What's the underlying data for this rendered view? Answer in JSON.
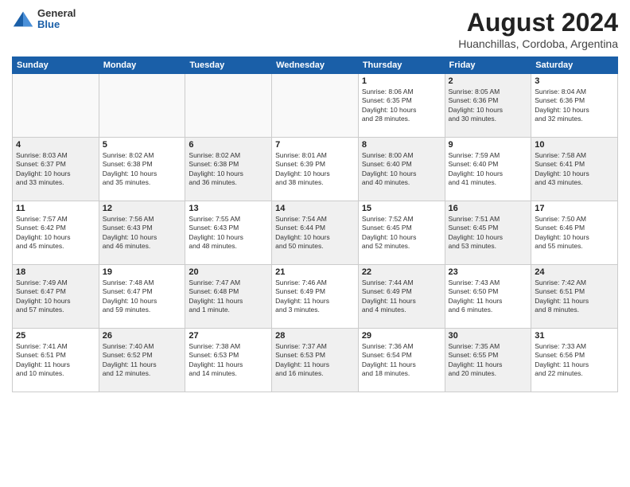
{
  "logo": {
    "general": "General",
    "blue": "Blue"
  },
  "title": "August 2024",
  "subtitle": "Huanchillas, Cordoba, Argentina",
  "headers": [
    "Sunday",
    "Monday",
    "Tuesday",
    "Wednesday",
    "Thursday",
    "Friday",
    "Saturday"
  ],
  "weeks": [
    [
      {
        "day": "",
        "info": "",
        "empty": true
      },
      {
        "day": "",
        "info": "",
        "empty": true
      },
      {
        "day": "",
        "info": "",
        "empty": true
      },
      {
        "day": "",
        "info": "",
        "empty": true
      },
      {
        "day": "1",
        "info": "Sunrise: 8:06 AM\nSunset: 6:35 PM\nDaylight: 10 hours\nand 28 minutes.",
        "shaded": false
      },
      {
        "day": "2",
        "info": "Sunrise: 8:05 AM\nSunset: 6:36 PM\nDaylight: 10 hours\nand 30 minutes.",
        "shaded": true
      },
      {
        "day": "3",
        "info": "Sunrise: 8:04 AM\nSunset: 6:36 PM\nDaylight: 10 hours\nand 32 minutes.",
        "shaded": false
      }
    ],
    [
      {
        "day": "4",
        "info": "Sunrise: 8:03 AM\nSunset: 6:37 PM\nDaylight: 10 hours\nand 33 minutes.",
        "shaded": true
      },
      {
        "day": "5",
        "info": "Sunrise: 8:02 AM\nSunset: 6:38 PM\nDaylight: 10 hours\nand 35 minutes.",
        "shaded": false
      },
      {
        "day": "6",
        "info": "Sunrise: 8:02 AM\nSunset: 6:38 PM\nDaylight: 10 hours\nand 36 minutes.",
        "shaded": true
      },
      {
        "day": "7",
        "info": "Sunrise: 8:01 AM\nSunset: 6:39 PM\nDaylight: 10 hours\nand 38 minutes.",
        "shaded": false
      },
      {
        "day": "8",
        "info": "Sunrise: 8:00 AM\nSunset: 6:40 PM\nDaylight: 10 hours\nand 40 minutes.",
        "shaded": true
      },
      {
        "day": "9",
        "info": "Sunrise: 7:59 AM\nSunset: 6:40 PM\nDaylight: 10 hours\nand 41 minutes.",
        "shaded": false
      },
      {
        "day": "10",
        "info": "Sunrise: 7:58 AM\nSunset: 6:41 PM\nDaylight: 10 hours\nand 43 minutes.",
        "shaded": true
      }
    ],
    [
      {
        "day": "11",
        "info": "Sunrise: 7:57 AM\nSunset: 6:42 PM\nDaylight: 10 hours\nand 45 minutes.",
        "shaded": false
      },
      {
        "day": "12",
        "info": "Sunrise: 7:56 AM\nSunset: 6:43 PM\nDaylight: 10 hours\nand 46 minutes.",
        "shaded": true
      },
      {
        "day": "13",
        "info": "Sunrise: 7:55 AM\nSunset: 6:43 PM\nDaylight: 10 hours\nand 48 minutes.",
        "shaded": false
      },
      {
        "day": "14",
        "info": "Sunrise: 7:54 AM\nSunset: 6:44 PM\nDaylight: 10 hours\nand 50 minutes.",
        "shaded": true
      },
      {
        "day": "15",
        "info": "Sunrise: 7:52 AM\nSunset: 6:45 PM\nDaylight: 10 hours\nand 52 minutes.",
        "shaded": false
      },
      {
        "day": "16",
        "info": "Sunrise: 7:51 AM\nSunset: 6:45 PM\nDaylight: 10 hours\nand 53 minutes.",
        "shaded": true
      },
      {
        "day": "17",
        "info": "Sunrise: 7:50 AM\nSunset: 6:46 PM\nDaylight: 10 hours\nand 55 minutes.",
        "shaded": false
      }
    ],
    [
      {
        "day": "18",
        "info": "Sunrise: 7:49 AM\nSunset: 6:47 PM\nDaylight: 10 hours\nand 57 minutes.",
        "shaded": true
      },
      {
        "day": "19",
        "info": "Sunrise: 7:48 AM\nSunset: 6:47 PM\nDaylight: 10 hours\nand 59 minutes.",
        "shaded": false
      },
      {
        "day": "20",
        "info": "Sunrise: 7:47 AM\nSunset: 6:48 PM\nDaylight: 11 hours\nand 1 minute.",
        "shaded": true
      },
      {
        "day": "21",
        "info": "Sunrise: 7:46 AM\nSunset: 6:49 PM\nDaylight: 11 hours\nand 3 minutes.",
        "shaded": false
      },
      {
        "day": "22",
        "info": "Sunrise: 7:44 AM\nSunset: 6:49 PM\nDaylight: 11 hours\nand 4 minutes.",
        "shaded": true
      },
      {
        "day": "23",
        "info": "Sunrise: 7:43 AM\nSunset: 6:50 PM\nDaylight: 11 hours\nand 6 minutes.",
        "shaded": false
      },
      {
        "day": "24",
        "info": "Sunrise: 7:42 AM\nSunset: 6:51 PM\nDaylight: 11 hours\nand 8 minutes.",
        "shaded": true
      }
    ],
    [
      {
        "day": "25",
        "info": "Sunrise: 7:41 AM\nSunset: 6:51 PM\nDaylight: 11 hours\nand 10 minutes.",
        "shaded": false
      },
      {
        "day": "26",
        "info": "Sunrise: 7:40 AM\nSunset: 6:52 PM\nDaylight: 11 hours\nand 12 minutes.",
        "shaded": true
      },
      {
        "day": "27",
        "info": "Sunrise: 7:38 AM\nSunset: 6:53 PM\nDaylight: 11 hours\nand 14 minutes.",
        "shaded": false
      },
      {
        "day": "28",
        "info": "Sunrise: 7:37 AM\nSunset: 6:53 PM\nDaylight: 11 hours\nand 16 minutes.",
        "shaded": true
      },
      {
        "day": "29",
        "info": "Sunrise: 7:36 AM\nSunset: 6:54 PM\nDaylight: 11 hours\nand 18 minutes.",
        "shaded": false
      },
      {
        "day": "30",
        "info": "Sunrise: 7:35 AM\nSunset: 6:55 PM\nDaylight: 11 hours\nand 20 minutes.",
        "shaded": true
      },
      {
        "day": "31",
        "info": "Sunrise: 7:33 AM\nSunset: 6:56 PM\nDaylight: 11 hours\nand 22 minutes.",
        "shaded": false
      }
    ]
  ]
}
